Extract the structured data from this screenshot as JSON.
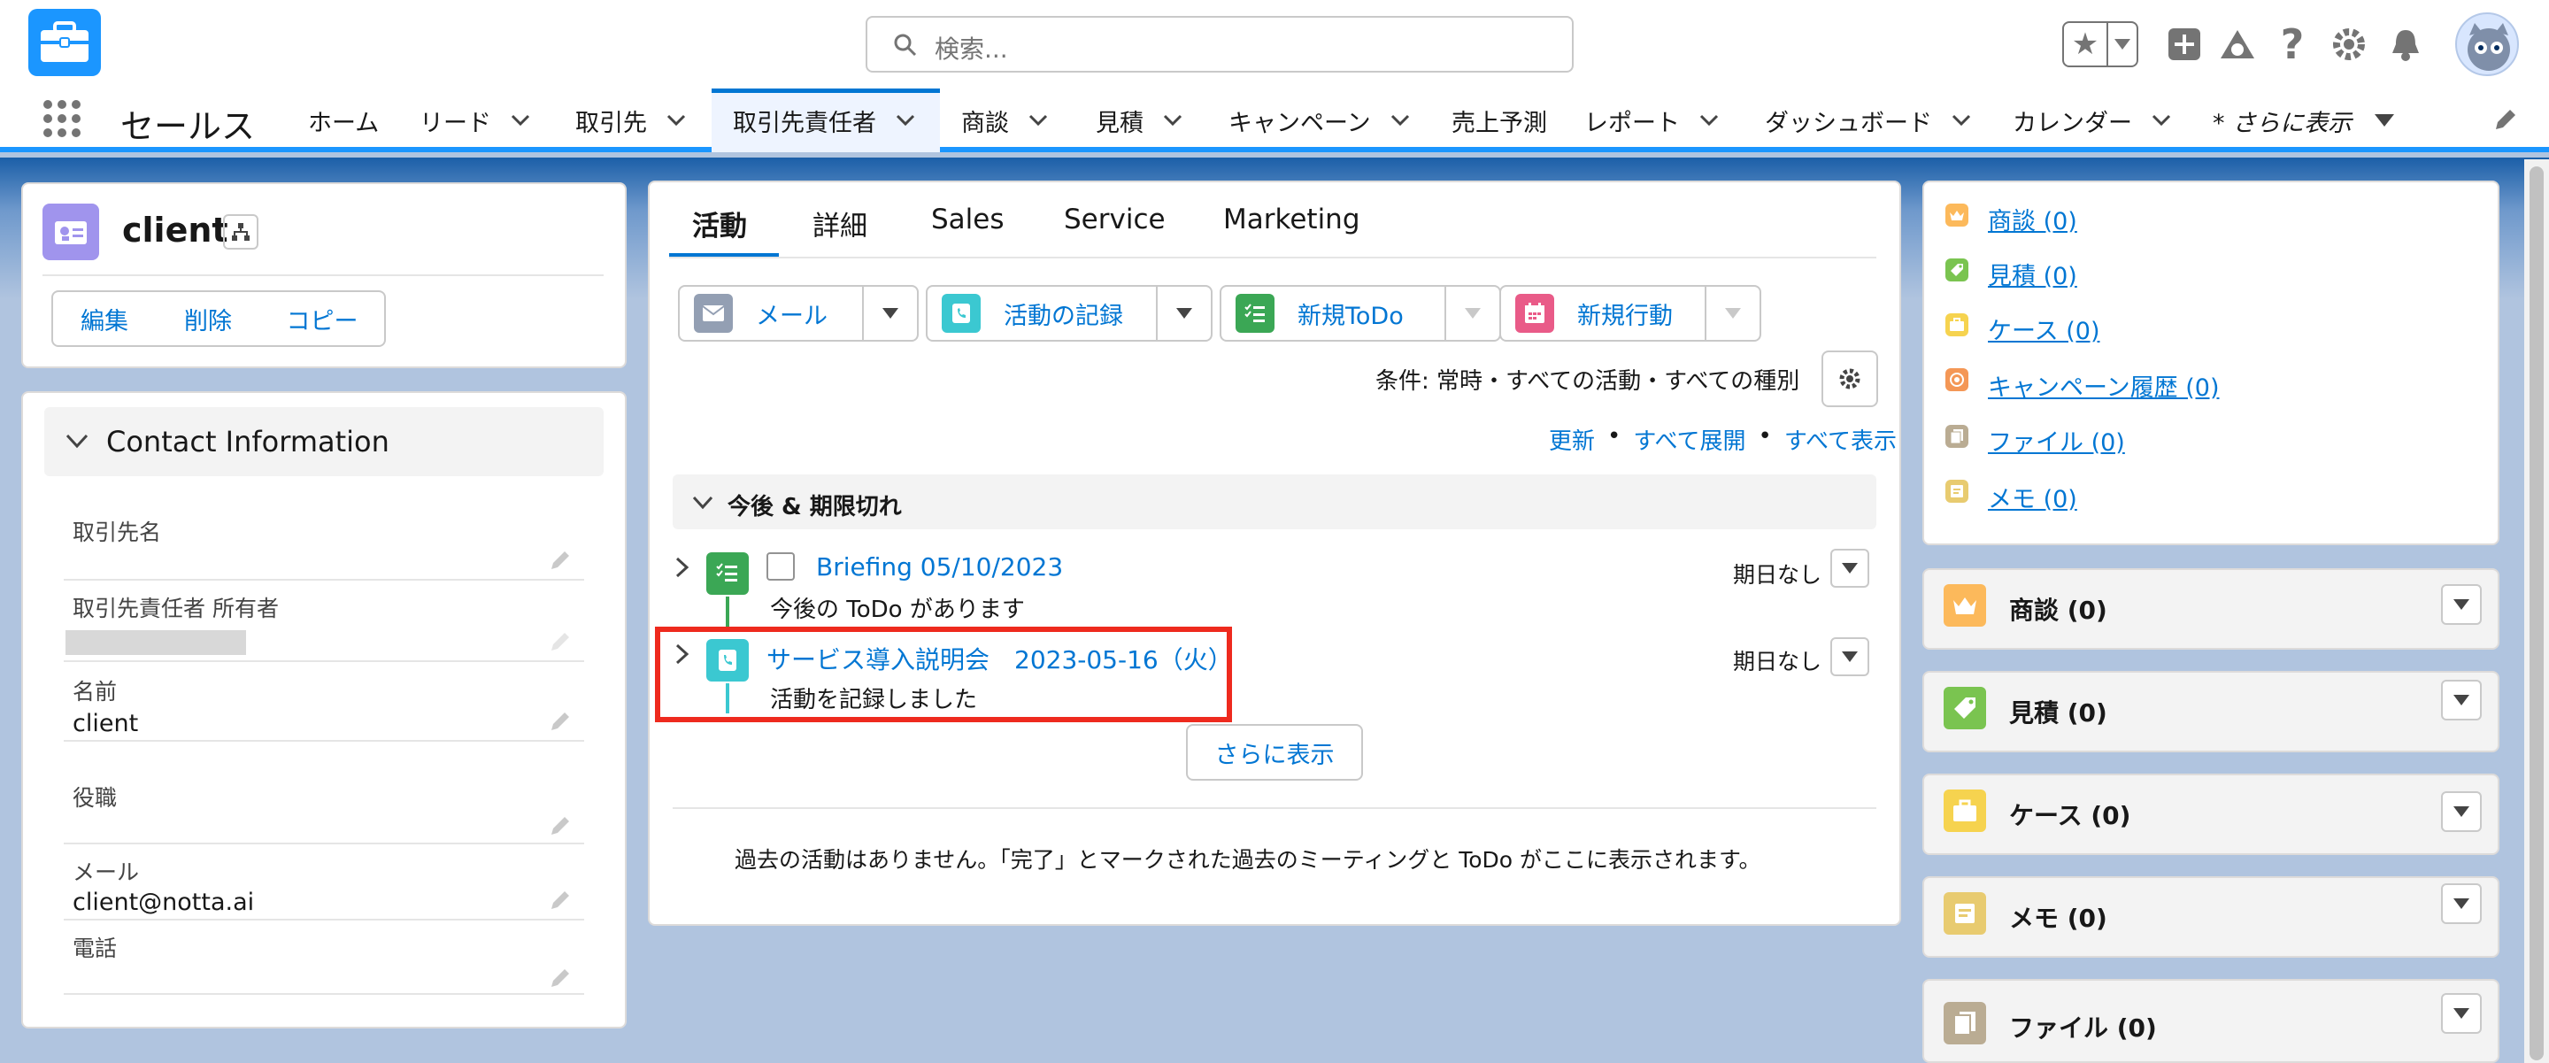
{
  "header": {
    "search_placeholder": "検索...",
    "icons": [
      "briefcase-logo",
      "search-icon",
      "favorites-star-icon",
      "chevron-down-icon",
      "add-icon",
      "trailhead-icon",
      "help-icon",
      "setup-gear-icon",
      "notifications-bell-icon",
      "user-avatar"
    ]
  },
  "nav": {
    "app_name": "セールス",
    "items": [
      {
        "label": "ホーム"
      },
      {
        "label": "リード"
      },
      {
        "label": "取引先"
      },
      {
        "label": "取引先責任者"
      },
      {
        "label": "商談"
      },
      {
        "label": "見積"
      },
      {
        "label": "キャンペーン"
      },
      {
        "label": "売上予測"
      },
      {
        "label": "レポート"
      },
      {
        "label": "ダッシュボード"
      },
      {
        "label": "カレンダー"
      }
    ],
    "more_label": "* さらに表示",
    "active": "取引先責任者"
  },
  "record": {
    "name": "client",
    "buttons": {
      "edit": "編集",
      "delete": "削除",
      "copy": "コピー"
    }
  },
  "details": {
    "section_title": "Contact Information",
    "fields": [
      {
        "label": "取引先名",
        "value": ""
      },
      {
        "label": "取引先責任者 所有者",
        "value": ""
      },
      {
        "label": "名前",
        "value": "client"
      },
      {
        "label": "役職",
        "value": ""
      },
      {
        "label": "メール",
        "value": "client@notta.ai"
      },
      {
        "label": "電話",
        "value": ""
      }
    ]
  },
  "center": {
    "tabs": [
      {
        "label": "活動"
      },
      {
        "label": "詳細"
      },
      {
        "label": "Sales"
      },
      {
        "label": "Service"
      },
      {
        "label": "Marketing"
      }
    ],
    "actions": [
      {
        "label": "メール",
        "color": "#939fb3"
      },
      {
        "label": "活動の記録",
        "color": "#3bc8d1"
      },
      {
        "label": "新規ToDo",
        "color": "#3ba755"
      },
      {
        "label": "新規行動",
        "color": "#e95b88"
      }
    ],
    "filter_text": "条件: 常時・すべての活動・すべての種別",
    "links": {
      "refresh": "更新",
      "expand_all": "すべて展開",
      "show_all": "すべて表示",
      "sep": "•"
    },
    "section_title": "今後 & 期限切れ",
    "timeline": [
      {
        "title": "Briefing 05/10/2023",
        "subtitle": "今後の ToDo があります",
        "due": "期日なし",
        "type": "task"
      },
      {
        "title": "サービス導入説明会　2023-05-16（火）",
        "subtitle": "活動を記録しました",
        "due": "期日なし",
        "type": "call",
        "highlighted": true
      }
    ],
    "show_more": "さらに表示",
    "past_text": "過去の活動はありません。「完了」とマークされた過去のミーティングと ToDo がここに表示されます。"
  },
  "right": {
    "related_links": [
      {
        "label": "商談 (0)",
        "color": "#fcb95b"
      },
      {
        "label": "見積 (0)",
        "color": "#7ac450"
      },
      {
        "label": "ケース (0)",
        "color": "#f6d34f"
      },
      {
        "label": "キャンペーン履歴 (0)",
        "color": "#f49756"
      },
      {
        "label": "ファイル (0)",
        "color": "#baac93"
      },
      {
        "label": "メモ (0)",
        "color": "#e8cb70"
      }
    ],
    "cards": [
      {
        "title": "商談 (0)",
        "color": "#fcb95b"
      },
      {
        "title": "見積 (0)",
        "color": "#7ac450"
      },
      {
        "title": "ケース (0)",
        "color": "#f6d34f"
      },
      {
        "title": "メモ (0)",
        "color": "#e8cb70"
      },
      {
        "title": "ファイル (0)",
        "color": "#baac93"
      }
    ]
  }
}
